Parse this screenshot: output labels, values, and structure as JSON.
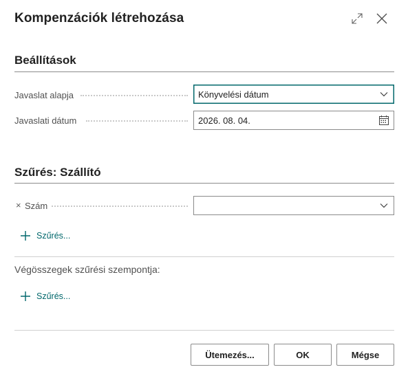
{
  "dialog": {
    "title": "Kompenzációk létrehozása",
    "expand_icon": "expand-icon",
    "close_icon": "close-icon"
  },
  "settings": {
    "title": "Beállítások",
    "fields": [
      {
        "label": "Javaslat alapja",
        "value": "Könyvelési dátum",
        "trail_icon": "chevron-down-icon"
      },
      {
        "label": "Javaslati dátum",
        "value": "2026. 08. 04.",
        "trail_icon": "calendar-icon"
      }
    ]
  },
  "filter_vendor": {
    "title": "Szűrés: Szállító",
    "remove_symbol": "×",
    "field_label": "Szám",
    "field_value": "",
    "add_filter_label": "Szűrés..."
  },
  "totals_filter": {
    "label": "Végösszegek szűrési szempontja:",
    "add_filter_label": "Szűrés..."
  },
  "buttons": {
    "schedule": "Ütemezés...",
    "ok": "OK",
    "cancel": "Mégse"
  },
  "colors": {
    "accent": "#00676b",
    "text": "#212121",
    "label": "#505050"
  }
}
